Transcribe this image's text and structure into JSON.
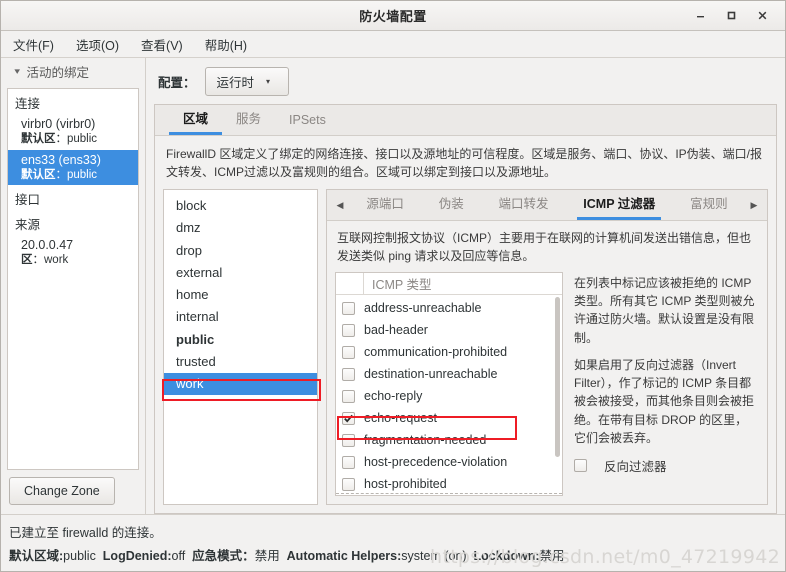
{
  "window": {
    "title": "防火墙配置",
    "minimize_icon": "minimize-icon",
    "maximize_icon": "maximize-icon",
    "close_icon": "close-icon"
  },
  "menubar": {
    "items": [
      {
        "label": "文件(F)"
      },
      {
        "label": "选项(O)"
      },
      {
        "label": "查看(V)"
      },
      {
        "label": "帮助(H)"
      }
    ]
  },
  "sidebar": {
    "header": "活动的绑定",
    "chevron": "▾",
    "groups": [
      {
        "title": "连接"
      },
      {
        "title": "接口"
      },
      {
        "title": "来源"
      }
    ],
    "connections": [
      {
        "name": "virbr0 (virbr0)",
        "sub_label": "默认区",
        "sub_value": "public",
        "selected": false
      },
      {
        "name": "ens33 (ens33)",
        "sub_label": "默认区",
        "sub_value": "public",
        "selected": true
      }
    ],
    "sources": [
      {
        "name": "20.0.0.47",
        "sub_label": "区",
        "sub_value": "work"
      }
    ],
    "change_zone_button": "Change Zone"
  },
  "config": {
    "label": "配置：",
    "selected": "运行时",
    "dropdown_arrow": "▾"
  },
  "top_tabs": [
    {
      "label": "区域",
      "active": true
    },
    {
      "label": "服务",
      "active": false
    },
    {
      "label": "IPSets",
      "active": false
    }
  ],
  "zone_description": "FirewallD 区域定义了绑定的网络连接、接口以及源地址的可信程度。区域是服务、端口、协议、IP伪装、端口/报文转发、ICMP过滤以及富规则的组合。区域可以绑定到接口以及源地址。",
  "zones": [
    {
      "name": "block",
      "bold": false,
      "selected": false
    },
    {
      "name": "dmz",
      "bold": false,
      "selected": false
    },
    {
      "name": "drop",
      "bold": false,
      "selected": false
    },
    {
      "name": "external",
      "bold": false,
      "selected": false
    },
    {
      "name": "home",
      "bold": false,
      "selected": false
    },
    {
      "name": "internal",
      "bold": false,
      "selected": false
    },
    {
      "name": "public",
      "bold": true,
      "selected": false
    },
    {
      "name": "trusted",
      "bold": false,
      "selected": false
    },
    {
      "name": "work",
      "bold": false,
      "selected": true
    }
  ],
  "sub_tabs": {
    "prev_arrow": "◀",
    "next_arrow": "▶",
    "items": [
      {
        "label": "源端口",
        "active": false
      },
      {
        "label": "伪装",
        "active": false
      },
      {
        "label": "端口转发",
        "active": false
      },
      {
        "label": "ICMP 过滤器",
        "active": true
      },
      {
        "label": "富规则",
        "active": false
      }
    ]
  },
  "icmp_description": "互联网控制报文协议（ICMP）主要用于在联网的计算机间发送出错信息，但也发送类似 ping 请求以及回应等信息。",
  "icmp_table": {
    "column_header": "ICMP 类型",
    "rows": [
      {
        "name": "address-unreachable",
        "checked": false,
        "highlighted": false
      },
      {
        "name": "bad-header",
        "checked": false,
        "highlighted": false
      },
      {
        "name": "communication-prohibited",
        "checked": false,
        "highlighted": false
      },
      {
        "name": "destination-unreachable",
        "checked": false,
        "highlighted": false
      },
      {
        "name": "echo-reply",
        "checked": false,
        "highlighted": false
      },
      {
        "name": "echo-request",
        "checked": true,
        "highlighted": true
      },
      {
        "name": "fragmentation-needed",
        "checked": false,
        "highlighted": false
      },
      {
        "name": "host-precedence-violation",
        "checked": false,
        "highlighted": false
      },
      {
        "name": "host-prohibited",
        "checked": false,
        "highlighted": false
      }
    ]
  },
  "icmp_notes": {
    "paragraph1": "在列表中标记应该被拒绝的 ICMP 类型。所有其它 ICMP 类型则被允许通过防火墙。默认设置是没有限制。",
    "paragraph2": "如果启用了反向过滤器（Invert Filter），作了标记的 ICMP 条目都被会被接受，而其他条目则会被拒绝。在带有目标 DROP 的区里，它们会被丢弃。",
    "invert_filter_label": "反向过滤器",
    "invert_filter_checked": false
  },
  "status": {
    "connection_line": "已建立至 firewalld 的连接。",
    "fields": [
      {
        "label": "默认区域:",
        "value": "public"
      },
      {
        "label": "LogDenied:",
        "value": "off"
      },
      {
        "label": "应急模式：",
        "value": "禁用"
      },
      {
        "label": "Automatic Helpers:",
        "value": "system (on)"
      },
      {
        "label": "Lockdown:",
        "value": "禁用"
      }
    ]
  },
  "watermark": "https://blog.csdn.net/m0_47219942",
  "colors": {
    "selection_blue": "#3d8ee0",
    "highlight_red": "#ee1c25",
    "window_bg": "#f2f1f0"
  }
}
